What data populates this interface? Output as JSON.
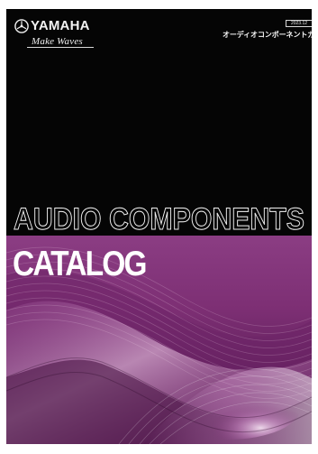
{
  "cover": {
    "brand": "YAMAHA",
    "tagline": "Make Waves",
    "date": "2023.12",
    "japanese_title": "オーディオコンポーネントカタログ",
    "headline_line1": "AUDIO COMPONENTS",
    "headline_line2": "CATALOG",
    "colors": {
      "background": "#050505",
      "purple": "#803377",
      "text": "#ffffff"
    },
    "icons": {
      "logo_mark": "tuning-forks-icon"
    }
  }
}
